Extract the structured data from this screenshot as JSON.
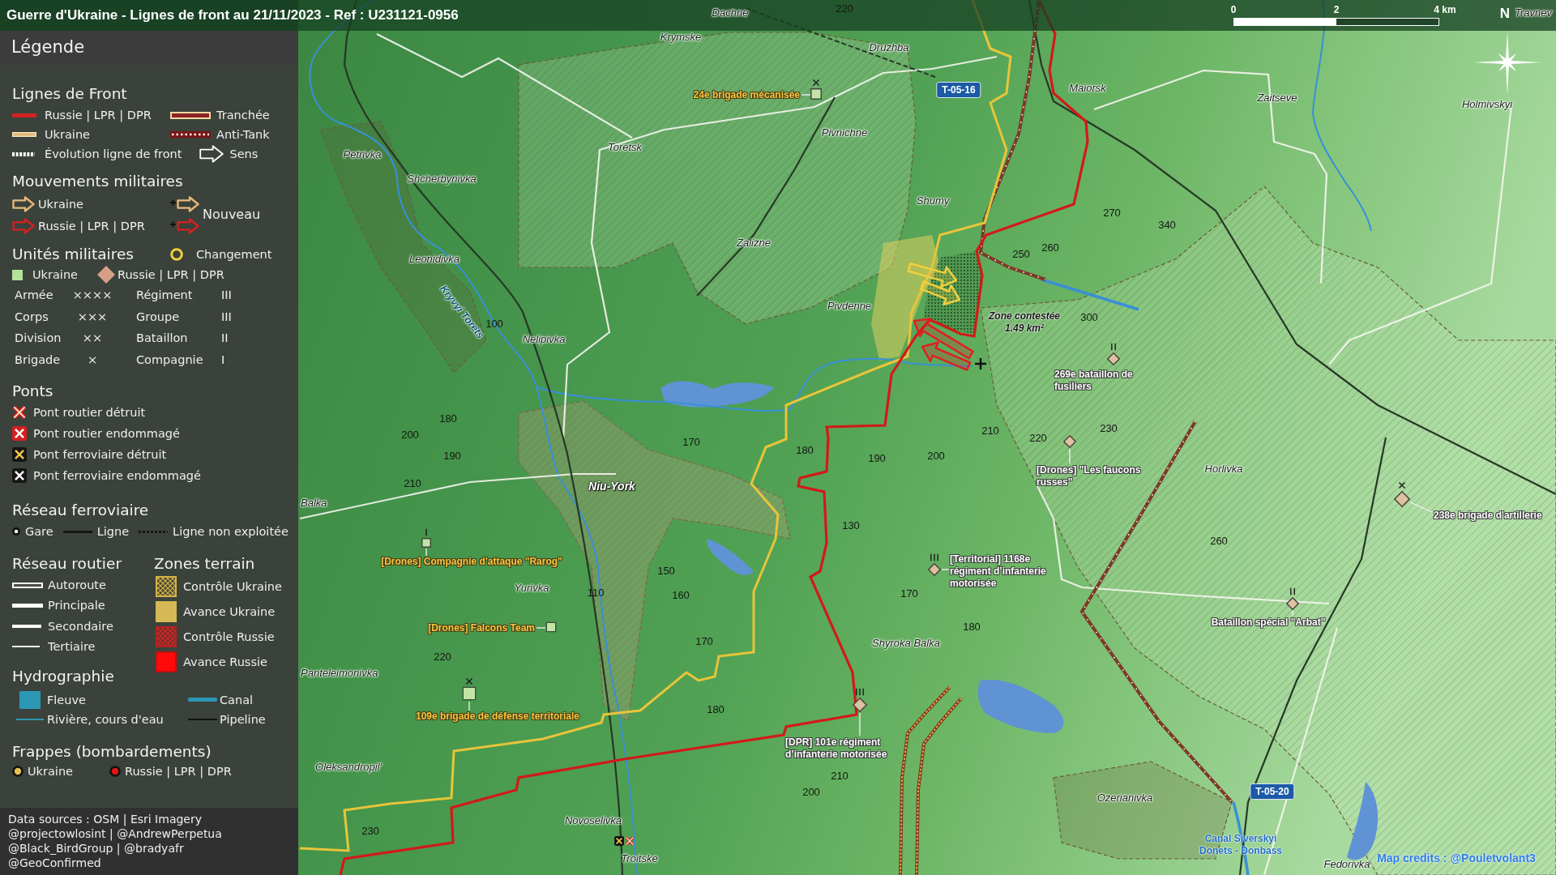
{
  "title": "Guerre d'Ukraine - Lignes de front au 21/11/2023 - Ref : U231121-0956",
  "scale_bar": {
    "ticks": [
      "0",
      "2",
      "4 km"
    ]
  },
  "north_arrow": {
    "label": "N"
  },
  "legend": {
    "title": "Légende",
    "front_lines": {
      "heading": "Lignes de Front",
      "items": [
        {
          "kind": "russia-line",
          "label": "Russie | LPR | DPR"
        },
        {
          "kind": "trench",
          "label": "Tranchée"
        },
        {
          "kind": "ukraine-line",
          "label": "Ukraine"
        },
        {
          "kind": "antitank",
          "label": "Anti-Tank"
        },
        {
          "kind": "evolution",
          "label": "Évolution ligne de front"
        },
        {
          "kind": "direction",
          "label": "Sens"
        }
      ]
    },
    "movements": {
      "heading": "Mouvements militaires",
      "items": [
        {
          "kind": "ukraine",
          "label": "Ukraine"
        },
        {
          "kind": "russia",
          "label": "Russie | LPR | DPR"
        }
      ],
      "new_label": "Nouveau"
    },
    "units": {
      "heading": "Unités militaires",
      "change_label": "Changement",
      "sides": [
        {
          "kind": "ukraine",
          "label": "Ukraine"
        },
        {
          "kind": "russia",
          "label": "Russie | LPR | DPR"
        }
      ],
      "echelons": [
        {
          "name": "Armée",
          "symbol": "××××"
        },
        {
          "name": "Régiment",
          "symbol": "III"
        },
        {
          "name": "Corps",
          "symbol": "×××"
        },
        {
          "name": "Groupe",
          "symbol": "III"
        },
        {
          "name": "Division",
          "symbol": "××"
        },
        {
          "name": "Bataillon",
          "symbol": "II"
        },
        {
          "name": "Brigade",
          "symbol": "×"
        },
        {
          "name": "Compagnie",
          "symbol": "I"
        }
      ]
    },
    "bridges": {
      "heading": "Ponts",
      "items": [
        {
          "kind": "road-destroyed",
          "label": "Pont routier détruit"
        },
        {
          "kind": "road-damaged",
          "label": "Pont routier endommagé"
        },
        {
          "kind": "rail-destroyed",
          "label": "Pont ferroviaire détruit"
        },
        {
          "kind": "rail-damaged",
          "label": "Pont ferroviaire endommagé"
        }
      ]
    },
    "railway": {
      "heading": "Réseau ferroviaire",
      "items": [
        {
          "kind": "station",
          "label": "Gare"
        },
        {
          "kind": "line",
          "label": "Ligne"
        },
        {
          "kind": "unused",
          "label": "Ligne non exploitée"
        }
      ]
    },
    "roads": {
      "heading": "Réseau routier",
      "items": [
        {
          "kind": "motorway",
          "label": "Autoroute"
        },
        {
          "kind": "primary",
          "label": "Principale"
        },
        {
          "kind": "secondary",
          "label": "Secondaire"
        },
        {
          "kind": "tertiary",
          "label": "Tertiaire"
        }
      ]
    },
    "zones": {
      "heading": "Zones terrain",
      "items": [
        {
          "kind": "ukraine-control",
          "label": "Contrôle Ukraine"
        },
        {
          "kind": "ukraine-advance",
          "label": "Avance Ukraine"
        },
        {
          "kind": "russia-control",
          "label": "Contrôle Russie"
        },
        {
          "kind": "russia-advance",
          "label": "Avance Russie"
        }
      ]
    },
    "hydrography": {
      "heading": "Hydrographie",
      "items": [
        {
          "kind": "river",
          "label": "Fleuve"
        },
        {
          "kind": "canal",
          "label": "Canal"
        },
        {
          "kind": "stream",
          "label": "Rivière, cours d'eau"
        },
        {
          "kind": "pipeline",
          "label": "Pipeline"
        }
      ]
    },
    "strikes": {
      "heading": "Frappes (bombardements)",
      "items": [
        {
          "kind": "ukraine",
          "label": "Ukraine"
        },
        {
          "kind": "russia",
          "label": "Russie | LPR | DPR"
        }
      ]
    },
    "sources": [
      "Data sources : OSM | Esri Imagery",
      "@projectowlosint | @AndrewPerpetua",
      "@Black_BirdGroup | @bradyafr",
      "@GeoConfirmed"
    ]
  },
  "map": {
    "places": [
      {
        "kind": "village",
        "name": "Dachne"
      },
      {
        "kind": "village",
        "name": "Travnev"
      },
      {
        "kind": "village",
        "name": "Krymske"
      },
      {
        "kind": "village",
        "name": "Druzhba"
      },
      {
        "kind": "village",
        "name": "Maiorsk"
      },
      {
        "kind": "village",
        "name": "Zaitseve"
      },
      {
        "kind": "village",
        "name": "Holmivskyi"
      },
      {
        "kind": "village",
        "name": "Pivnichne"
      },
      {
        "kind": "village",
        "name": "Toretsk"
      },
      {
        "kind": "village",
        "name": "Petrivka"
      },
      {
        "kind": "village",
        "name": "Shcherbynivka"
      },
      {
        "kind": "village",
        "name": "Shumy"
      },
      {
        "kind": "village",
        "name": "Zalizne"
      },
      {
        "kind": "village",
        "name": "Leonidivka"
      },
      {
        "kind": "village",
        "name": "Pivdenne"
      },
      {
        "kind": "village",
        "name": "Nelipivka"
      },
      {
        "kind": "village",
        "name": "Horlivka"
      },
      {
        "kind": "town",
        "name": "Niu-York"
      },
      {
        "kind": "village",
        "name": "Balka"
      },
      {
        "kind": "village",
        "name": "Yurivka"
      },
      {
        "kind": "village",
        "name": "Shyroka Balka"
      },
      {
        "kind": "village",
        "name": "Panteleimonivka"
      },
      {
        "kind": "village",
        "name": "Oleksandropil'"
      },
      {
        "kind": "village",
        "name": "Ozerianivka"
      },
      {
        "kind": "village",
        "name": "Novoselivka"
      },
      {
        "kind": "village",
        "name": "Troitske"
      },
      {
        "kind": "village",
        "name": "Fedorivka"
      }
    ],
    "elevations": [
      "220",
      "270",
      "340",
      "250",
      "260",
      "100",
      "300",
      "200",
      "180",
      "210",
      "220",
      "230",
      "190",
      "170",
      "180",
      "190",
      "200",
      "210",
      "130",
      "260",
      "150",
      "110",
      "160",
      "170",
      "180",
      "170",
      "220",
      "180",
      "210",
      "200",
      "230"
    ],
    "river_label": "Kryvyi Torets",
    "road_refs": [
      "T-05-16",
      "T-05-20"
    ],
    "contested_zone": {
      "label": "Zone contestée",
      "area": "1.49 km²"
    },
    "units": [
      {
        "kind": "ukraine",
        "echelon": {
          "kind": "brigade"
        },
        "lines": [
          "24e brigade mécanisée"
        ]
      },
      {
        "kind": "russia",
        "echelon": {
          "kind": "battalion"
        },
        "lines": [
          "269e bataillon de",
          "fusiliers"
        ]
      },
      {
        "kind": "russia",
        "lines": [
          "[Drones] \"Les faucons",
          "russes\""
        ]
      },
      {
        "kind": "russia",
        "echelon": {
          "kind": "brigade"
        },
        "lines": [
          "238e brigade d'artillerie"
        ]
      },
      {
        "kind": "ukraine",
        "echelon": {
          "kind": "company"
        },
        "lines": [
          "[Drones] Compagnie d'attaque \"Rarog\""
        ]
      },
      {
        "kind": "russia",
        "echelon": {
          "kind": "regiment"
        },
        "lines": [
          "[Territorial] 1168e",
          "régiment d’infanterie",
          "motorisée"
        ]
      },
      {
        "kind": "russia",
        "echelon": {
          "kind": "battalion"
        },
        "lines": [
          "Bataillon spécial \"Arbat\""
        ]
      },
      {
        "kind": "ukraine",
        "lines": [
          "[Drones] Falcons Team"
        ]
      },
      {
        "kind": "ukraine",
        "echelon": {
          "kind": "brigade"
        },
        "lines": [
          "109e brigade de défense territoriale"
        ]
      },
      {
        "kind": "russia",
        "echelon": {
          "kind": "regiment"
        },
        "lines": [
          "[DPR] 101e régiment",
          "d’infanterie motorisée"
        ]
      }
    ],
    "bridges": [
      {
        "kind": "rail-destroyed"
      },
      {
        "kind": "road-destroyed"
      }
    ],
    "canal_label": [
      "Canal Siverskyi",
      "Donets - Donbass"
    ],
    "credits": "Map credits : @Pouletvolant3"
  }
}
